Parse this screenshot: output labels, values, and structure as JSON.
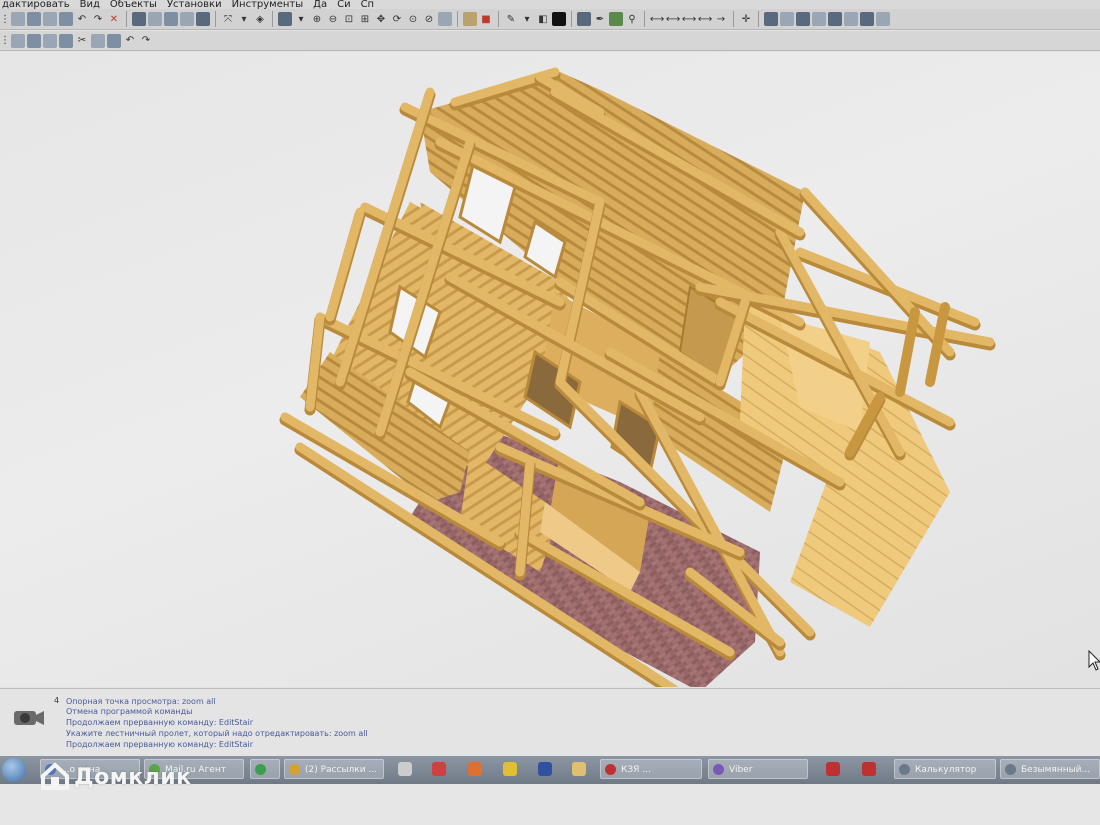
{
  "menu": {
    "items": [
      "дактировать",
      "Вид",
      "Объекты",
      "Установки",
      "Инструменты",
      "Да",
      "Си",
      "Сп"
    ]
  },
  "toolbar": {
    "icons_row1": [
      "save-icon",
      "print-icon",
      "open-icon",
      "new-icon",
      "undo-icon",
      "redo-icon",
      "delete-icon",
      "layer-icon",
      "view-icon",
      "wall-icon",
      "rotate-icon",
      "snap-icon",
      "camera-icon",
      "zoom-in-icon",
      "zoom-out-icon",
      "zoom-window-icon",
      "zoom-all-icon",
      "pan-icon",
      "orbit-icon",
      "render-icon",
      "color-icon",
      "light-icon",
      "pin-icon",
      "dimension-icon",
      "panel-icon"
    ],
    "icons_row2": [
      "cut-icon",
      "copy-icon",
      "paste-icon",
      "undo-icon",
      "redo-icon"
    ]
  },
  "viewport": {
    "scene": "3D модель бревенчатого дома"
  },
  "command_panel": {
    "line_number": "4",
    "lines": [
      "Опорная точка просмотра: zoom all",
      "Отмена программой команды",
      "Продолжаем прерванную команду: EditStair",
      "Укажите лестничный пролет, который надо отредактировать: zoom all",
      "Продолжаем прерванную команду: EditStair"
    ]
  },
  "taskbar": {
    "items": [
      {
        "label": "...о окна",
        "color": "#4a78b8"
      },
      {
        "label": "Mail.ru Агент",
        "color": "#5aa54a"
      },
      {
        "label": "",
        "color": "#3aa050"
      },
      {
        "label": "(2) Рассылки ...",
        "color": "#d8a030"
      },
      {
        "label": "",
        "color": "#cccccc"
      },
      {
        "label": "",
        "color": "#d04040"
      },
      {
        "label": "",
        "color": "#e07030"
      },
      {
        "label": "",
        "color": "#e0c030"
      },
      {
        "label": "",
        "color": "#3050a0"
      },
      {
        "label": "",
        "color": "#e0c070"
      },
      {
        "label": "КЗЯ ...",
        "color": "#c03030"
      },
      {
        "label": "Viber",
        "color": "#7a5ab8"
      },
      {
        "label": "",
        "color": "#c03030"
      },
      {
        "label": "",
        "color": "#c03030"
      },
      {
        "label": "Калькулятор",
        "color": "#6a7a8a"
      },
      {
        "label": "Безымянный...",
        "color": "#6a7a8a"
      }
    ]
  },
  "watermark": {
    "text": "Домклик"
  },
  "colors": {
    "log": "#e2b866",
    "log_shadow": "#b98a3c",
    "brick": "#9a6a6a",
    "deck": "#f0ca7c"
  }
}
